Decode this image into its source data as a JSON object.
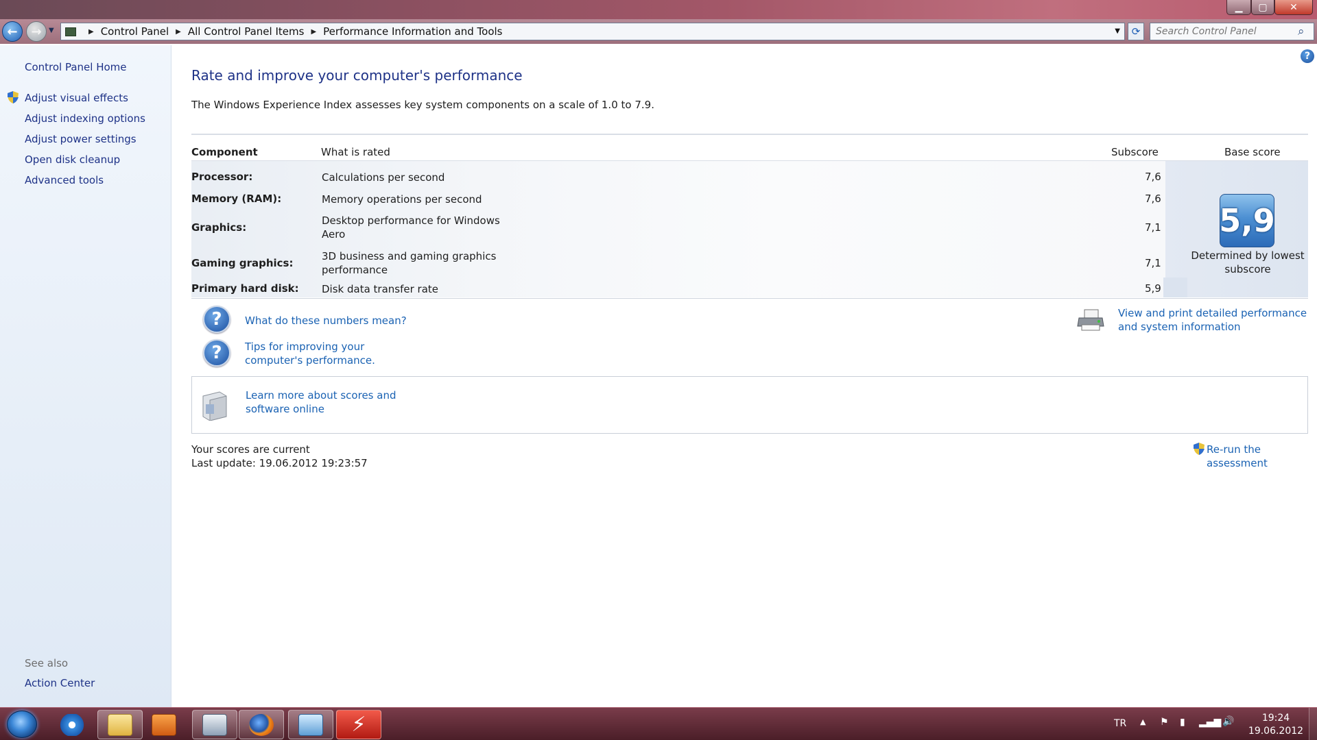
{
  "window": {
    "search_placeholder": "Search Control Panel",
    "breadcrumbs": [
      "Control Panel",
      "All Control Panel Items",
      "Performance Information and Tools"
    ],
    "min_glyph": "▁",
    "max_glyph": "▢",
    "close_glyph": "✕"
  },
  "left": {
    "home": "Control Panel Home",
    "links": [
      "Adjust visual effects",
      "Adjust indexing options",
      "Adjust power settings",
      "Open disk cleanup",
      "Advanced tools"
    ],
    "see_also": "See also",
    "action_center": "Action Center"
  },
  "main": {
    "title": "Rate and improve your computer's performance",
    "description": "The Windows Experience Index assesses key system components on a scale of 1.0 to 7.9.",
    "headers": {
      "component": "Component",
      "rated": "What is rated",
      "subscore": "Subscore",
      "base": "Base score"
    },
    "rows": [
      {
        "component": "Processor:",
        "rated": "Calculations per second",
        "subscore": "7,6"
      },
      {
        "component": "Memory (RAM):",
        "rated": "Memory operations per second",
        "subscore": "7,6"
      },
      {
        "component": "Graphics:",
        "rated": "Desktop performance for Windows Aero",
        "subscore": "7,1"
      },
      {
        "component": "Gaming graphics:",
        "rated": "3D business and gaming graphics performance",
        "subscore": "7,1"
      },
      {
        "component": "Primary hard disk:",
        "rated": "Disk data transfer rate",
        "subscore": "5,9"
      }
    ],
    "base_score": "5,9",
    "base_caption": "Determined by lowest subscore",
    "link_numbers": "What do these numbers mean?",
    "link_tips": "Tips for improving your computer's performance.",
    "link_print": "View and print detailed performance and system information",
    "link_learn": "Learn more about scores and software online",
    "scores_current": "Your scores are current",
    "last_update": "Last update: 19.06.2012 19:23:57",
    "rerun": "Re-run the assessment"
  },
  "taskbar": {
    "language": "TR",
    "time": "19:24",
    "date": "19.06.2012"
  },
  "colors": {
    "link": "#1a62b3",
    "heading": "#1e3287",
    "accent": "#2c6bb8"
  }
}
